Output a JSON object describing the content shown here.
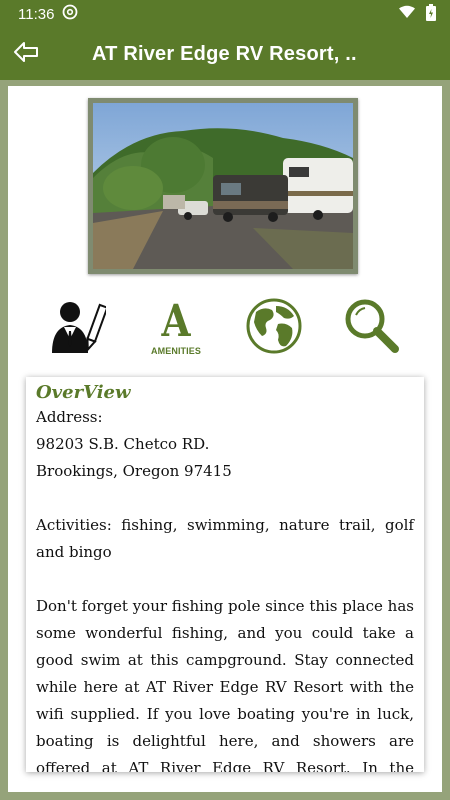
{
  "status": {
    "time": "11:36"
  },
  "appbar": {
    "title": "AT River Edge RV Resort, .."
  },
  "icons": {
    "amenities_letter": "A",
    "amenities_label": "AMENITIES"
  },
  "overview": {
    "heading": "OverView",
    "address_label": "Address:",
    "address_line1": "98203 S.B. Chetco RD.",
    "address_line2": "Brookings, Oregon 97415",
    "activities": "Activities: fishing, swimming, nature trail, golf and bingo",
    "description": "Don't forget your fishing pole since this place has some wonderful fishing, and you could take a good swim at this campground. Stay connected while here at AT River Edge RV Resort with the wifi supplied. If you love boating you're in luck, boating is delightful here, and showers are offered at AT River Edge RV Resort. In the laundry machine room you can wash"
  },
  "colors": {
    "primary": "#5a7a2a",
    "background": "#95a37a"
  }
}
